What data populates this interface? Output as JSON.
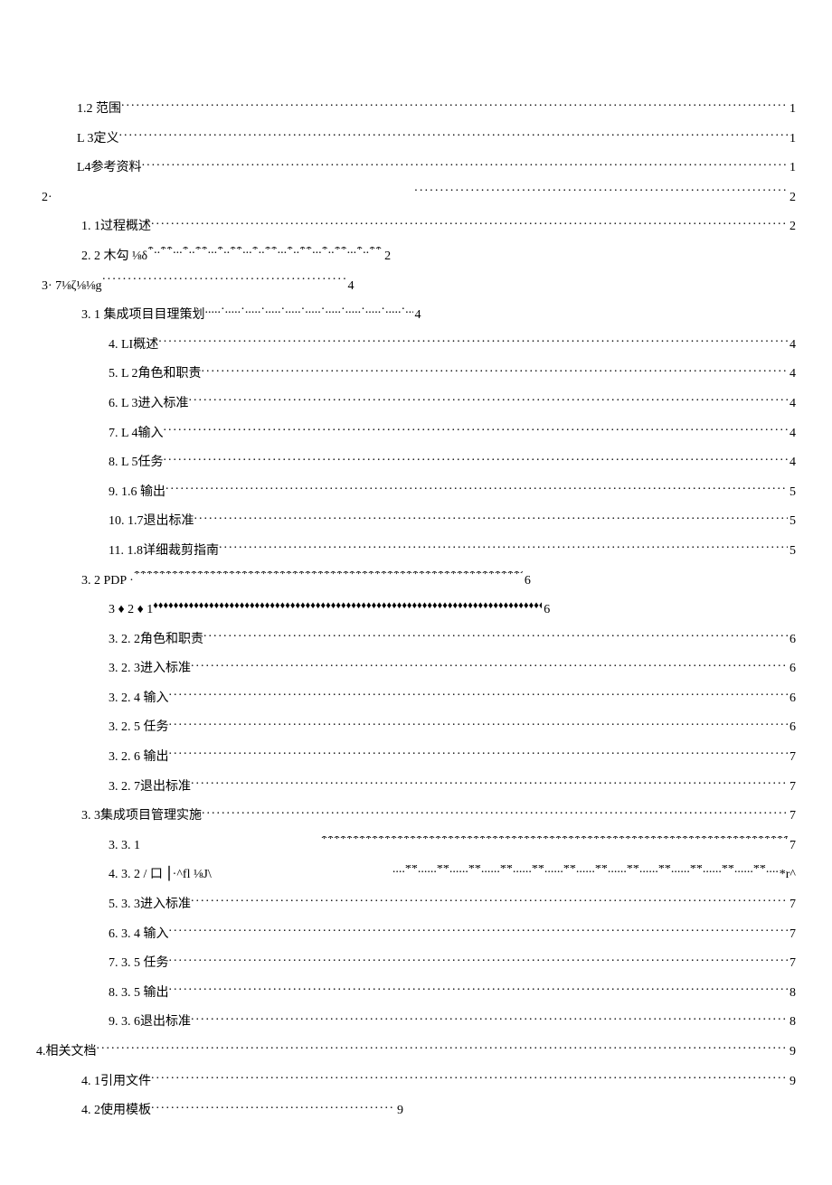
{
  "toc": {
    "r1": {
      "label": "1.2   范围",
      "page": "1"
    },
    "r2": {
      "label": "L 3定义",
      "page": "1"
    },
    "r3": {
      "label": "L4参考资料",
      "page": "1"
    },
    "r4": {
      "label": "2·",
      "page": "2"
    },
    "r5": {
      "label": "1.   1过程概述",
      "page": "2"
    },
    "r6": {
      "label": "2.   2 木勾  ⅛δ ",
      "page": "2"
    },
    "r7": {
      "label": "3·        7⅛ζ⅛⅛g",
      "page": "4"
    },
    "r8": {
      "label": "3.   1 集成项目目理策划",
      "page": "4"
    },
    "r9": {
      "label": "4.   LI概述",
      "page": "4"
    },
    "r10": {
      "label": "5.   L 2角色和职责",
      "page": "4"
    },
    "r11": {
      "label": "6.   L 3进入标准",
      "page": "4"
    },
    "r12": {
      "label": "7.   L 4输入",
      "page": "4"
    },
    "r13": {
      "label": "8.   L 5任务",
      "page": "4"
    },
    "r14": {
      "label": "9.   1.6 输出",
      "page": "5"
    },
    "r15": {
      "label": "10. 1.7退出标准",
      "page": "5"
    },
    "r16": {
      "label": "11. 1.8详细裁剪指南",
      "page": "5"
    },
    "r17": {
      "label": "3. 2              PDP ·",
      "page": "6"
    },
    "r18": {
      "label": "3 ♦ 2 ♦ 1     ",
      "page": " 6"
    },
    "r19": {
      "label": "3. 2. 2角色和职责",
      "page": "6"
    },
    "r20": {
      "label": "3. 2. 3进入标准",
      "page": "6"
    },
    "r21": {
      "label": "3. 2. 4 输入",
      "page": "6"
    },
    "r22": {
      "label": "3. 2. 5 任务",
      "page": "6"
    },
    "r23": {
      "label": "3. 2. 6 输出",
      "page": "7"
    },
    "r24": {
      "label": "3. 2. 7退出标准",
      "page": "7"
    },
    "r25": {
      "label": "3.   3集成项目管理实施",
      "page": "7"
    },
    "r26": {
      "label": "3.   3. 1",
      "page": "7"
    },
    "r27": {
      "label": "4.   3. 2 / 口  ⎮·^fl ⅛J\\",
      "page": "*r^"
    },
    "r28": {
      "label": "5.   3. 3进入标准",
      "page": "7"
    },
    "r29": {
      "label": "6.   3. 4 输入",
      "page": "7"
    },
    "r30": {
      "label": "7.   3. 5 任务",
      "page": "7"
    },
    "r31": {
      "label": "8.   3. 5 输出",
      "page": "8"
    },
    "r32": {
      "label": "9.   3. 6退出标准",
      "page": "8"
    },
    "r33": {
      "label": "4.相关文档",
      "page": "9"
    },
    "r34": {
      "label": "4.   1引用文件",
      "page": "9"
    },
    "r35": {
      "label": "4.   2使用模板",
      "page": "9"
    }
  }
}
